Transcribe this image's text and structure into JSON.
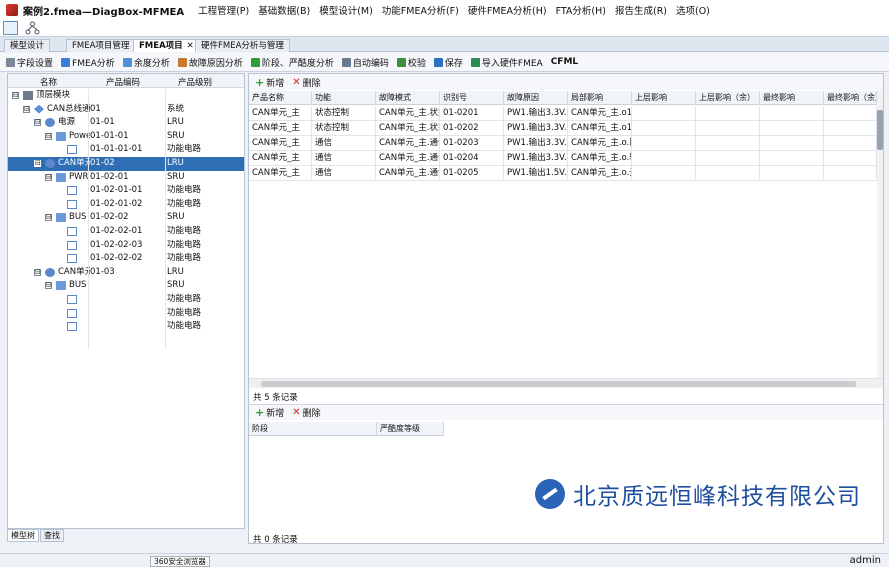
{
  "window": {
    "title": "案例2.fmea—DiagBox-MFMEA"
  },
  "menu": [
    "工程管理(P)",
    "基础数据(B)",
    "模型设计(M)",
    "功能FMEA分析(F)",
    "硬件FMEA分析(H)",
    "FTA分析(H)",
    "报告生成(R)",
    "选项(O)"
  ],
  "tabs": [
    {
      "label": "模型设计",
      "active": false
    },
    {
      "label": "FMEA项目管理",
      "active": false
    },
    {
      "label": "FMEA项目",
      "active": true,
      "close": "✕"
    },
    {
      "label": "硬件FMEA分析与管理",
      "active": false
    }
  ],
  "toolbar": [
    "字段设置",
    "FMEA分析",
    "余度分析",
    "故障原因分析",
    "阶段、严酷度分析",
    "自动编码",
    "校验",
    "保存",
    "导入硬件FMEA",
    "CFML"
  ],
  "tree": {
    "columns": [
      "名称",
      "产品编码",
      "产品级别"
    ],
    "rows": [
      {
        "depth": 0,
        "toggle": "⊟",
        "icon": "top",
        "name": "顶层模块",
        "code": "",
        "level": ""
      },
      {
        "depth": 1,
        "toggle": "⊟",
        "icon": "sys",
        "name": "CAN总线通信",
        "code": "01",
        "level": "系统"
      },
      {
        "depth": 2,
        "toggle": "⊟",
        "icon": "lru",
        "name": "电源",
        "code": "01-01",
        "level": "LRU"
      },
      {
        "depth": 3,
        "toggle": "⊟",
        "icon": "sru",
        "name": "Power",
        "code": "01-01-01",
        "level": "SRU"
      },
      {
        "depth": 4,
        "toggle": "",
        "icon": "fc",
        "name": "",
        "code": "01-01-01-01",
        "level": "功能电路"
      },
      {
        "depth": 2,
        "toggle": "⊟",
        "icon": "lru",
        "name": "CAN单元",
        "code": "01-02",
        "level": "LRU",
        "selected": true
      },
      {
        "depth": 3,
        "toggle": "⊟",
        "icon": "sru",
        "name": "PWR",
        "code": "01-02-01",
        "level": "SRU"
      },
      {
        "depth": 4,
        "toggle": "",
        "icon": "fc",
        "name": "",
        "code": "01-02-01-01",
        "level": "功能电路"
      },
      {
        "depth": 4,
        "toggle": "",
        "icon": "fc",
        "name": "",
        "code": "01-02-01-02",
        "level": "功能电路"
      },
      {
        "depth": 3,
        "toggle": "⊟",
        "icon": "sru",
        "name": "BUS",
        "code": "01-02-02",
        "level": "SRU"
      },
      {
        "depth": 4,
        "toggle": "",
        "icon": "fc",
        "name": "",
        "code": "01-02-02-01",
        "level": "功能电路"
      },
      {
        "depth": 4,
        "toggle": "",
        "icon": "fc",
        "name": "",
        "code": "01-02-02-03",
        "level": "功能电路"
      },
      {
        "depth": 4,
        "toggle": "",
        "icon": "fc",
        "name": "",
        "code": "01-02-02-02",
        "level": "功能电路"
      },
      {
        "depth": 2,
        "toggle": "⊟",
        "icon": "lru",
        "name": "CAN单元",
        "code": "01-03",
        "level": "LRU"
      },
      {
        "depth": 3,
        "toggle": "⊟",
        "icon": "sru",
        "name": "BUS",
        "code": "",
        "level": "SRU"
      },
      {
        "depth": 4,
        "toggle": "",
        "icon": "fc",
        "name": "",
        "code": "",
        "level": "功能电路"
      },
      {
        "depth": 4,
        "toggle": "",
        "icon": "fc",
        "name": "",
        "code": "",
        "level": "功能电路"
      },
      {
        "depth": 4,
        "toggle": "",
        "icon": "fc",
        "name": "",
        "code": "",
        "level": "功能电路"
      }
    ]
  },
  "bottom_tabs": [
    "模型树",
    "查找"
  ],
  "upper": {
    "add": "新增",
    "delete": "删除",
    "columns": [
      "产品名称",
      "功能",
      "故障模式",
      "识别号",
      "故障原因",
      "局部影响",
      "上层影响",
      "上层影响（余）",
      "最终影响",
      "最终影响（余）"
    ],
    "rows": [
      [
        "CAN单元_主",
        "状态控制",
        "CAN单元_主.状态",
        "01-0201",
        "PW1.输出3.3V.故",
        "CAN单元_主.o1.",
        "",
        "",
        "",
        ""
      ],
      [
        "CAN单元_主",
        "状态控制",
        "CAN单元_主.状态",
        "01-0202",
        "PW1.输出3.3V.故",
        "CAN单元_主.o1.",
        "",
        "",
        "",
        ""
      ],
      [
        "CAN单元_主",
        "通信",
        "CAN单元_主.通信",
        "01-0203",
        "PW1.输出3.3V.故",
        "CAN单元_主.o.降",
        "",
        "",
        "",
        ""
      ],
      [
        "CAN单元_主",
        "通信",
        "CAN单元_主.通信",
        "01-0204",
        "PW1.输出3.3V.故",
        "CAN单元_主.o.输",
        "",
        "",
        "",
        ""
      ],
      [
        "CAN单元_主",
        "通信",
        "CAN单元_主.通信",
        "01-0205",
        "PW1.输出1.5V.故",
        "CAN单元_主.o.无",
        "",
        "",
        "",
        ""
      ]
    ],
    "status": "共 5 条记录"
  },
  "lower": {
    "add": "新增",
    "delete": "删除",
    "columns": [
      "阶段",
      "严酷度等级"
    ],
    "status": "共 0 条记录"
  },
  "watermark": "北京质远恒峰科技有限公司",
  "statusbar": {
    "browser": "360安全浏览器",
    "user": "admin"
  }
}
